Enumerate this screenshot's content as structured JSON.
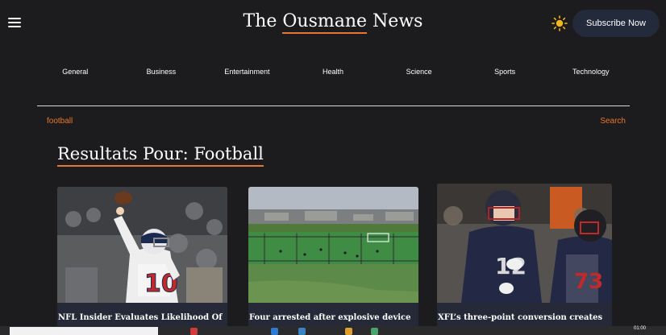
{
  "header": {
    "brand_prefix": "The ",
    "brand_highlight": "Ousmane",
    "brand_suffix": " News",
    "subscribe_label": "Subscribe Now",
    "menu_icon": "hamburger-menu-icon",
    "theme_icon": "sun-icon"
  },
  "nav": [
    "General",
    "Business",
    "Entertainment",
    "Health",
    "Science",
    "Sports",
    "Technology"
  ],
  "search": {
    "value": "football",
    "button_label": "Search"
  },
  "results_heading": "Resultats Pour: Football",
  "articles": [
    {
      "title": "NFL Insider Evaluates Likelihood Of"
    },
    {
      "title": "Four arrested after explosive device"
    },
    {
      "title": "XFL’s three-point conversion creates"
    }
  ],
  "taskbar": {
    "clock": "01:00"
  },
  "colors": {
    "accent": "#e8772e",
    "background": "#1c1b1d",
    "card": "#252938",
    "subscribe_bg": "#232a3b"
  }
}
